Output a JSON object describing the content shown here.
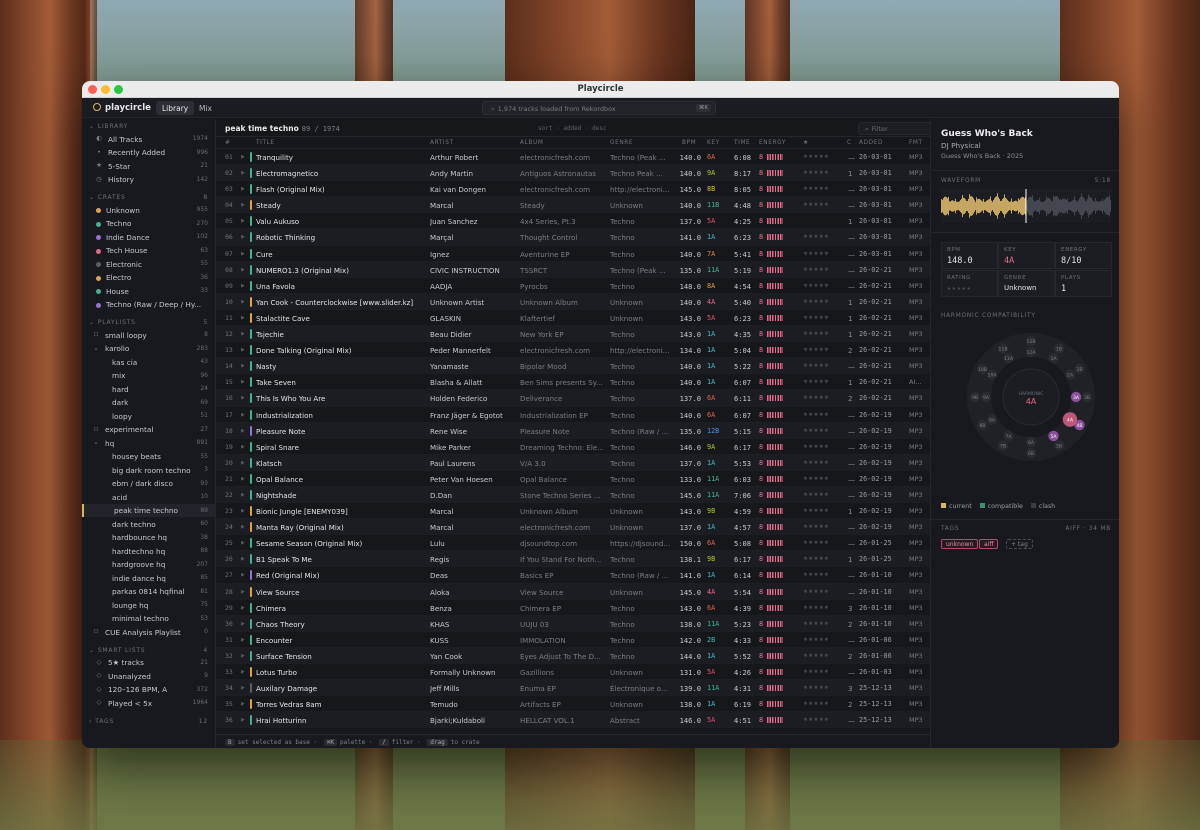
{
  "window": {
    "title": "Playcircle"
  },
  "toolbar": {
    "brand": "playcircle",
    "tabs": [
      "Library",
      "Mix"
    ],
    "search_text": "1,974 tracks loaded from Rekordbox",
    "search_kbd": "⌘K"
  },
  "sidebar": {
    "library": {
      "label": "LIBRARY",
      "items": [
        {
          "label": "All Tracks",
          "count": "1974",
          "icon": "disc-icon"
        },
        {
          "label": "Recently Added",
          "count": "996",
          "icon": "dot-icon"
        },
        {
          "label": "5-Star",
          "count": "21",
          "icon": "star-icon"
        },
        {
          "label": "History",
          "count": "142",
          "icon": "clock-icon"
        }
      ]
    },
    "crates": {
      "label": "CRATES",
      "count": "8",
      "items": [
        {
          "label": "Unknown",
          "count": "955",
          "color": "#e0a24a"
        },
        {
          "label": "Techno",
          "count": "270",
          "color": "#4caf8a"
        },
        {
          "label": "Indie Dance",
          "count": "102",
          "color": "#9a72d6"
        },
        {
          "label": "Tech House",
          "count": "63",
          "color": "#e26a84"
        },
        {
          "label": "Electronic",
          "count": "55",
          "color": "#5a5d66"
        },
        {
          "label": "Electro",
          "count": "36",
          "color": "#e0a24a"
        },
        {
          "label": "House",
          "count": "33",
          "color": "#4caf8a"
        },
        {
          "label": "Techno (Raw / Deep / Hy...",
          "count": "",
          "color": "#9a72d6"
        }
      ]
    },
    "playlists": {
      "label": "PLAYLISTS",
      "count": "5",
      "items": [
        {
          "label": "small loopy",
          "count": "8",
          "depth": 0,
          "icon": "folder"
        },
        {
          "label": "karolio",
          "count": "283",
          "depth": 0,
          "icon": "chevron"
        },
        {
          "label": "kas cia",
          "count": "43",
          "depth": 1
        },
        {
          "label": "mix",
          "count": "96",
          "depth": 1
        },
        {
          "label": "hard",
          "count": "24",
          "depth": 1
        },
        {
          "label": "dark",
          "count": "69",
          "depth": 1
        },
        {
          "label": "loopy",
          "count": "51",
          "depth": 1
        },
        {
          "label": "experimental",
          "count": "27",
          "depth": 0,
          "icon": "folder"
        },
        {
          "label": "hq",
          "count": "891",
          "depth": 0,
          "icon": "chevron"
        },
        {
          "label": "housey beats",
          "count": "55",
          "depth": 1
        },
        {
          "label": "big dark room techno",
          "count": "3",
          "depth": 1
        },
        {
          "label": "ebm / dark disco",
          "count": "93",
          "depth": 1
        },
        {
          "label": "acid",
          "count": "10",
          "depth": 1
        },
        {
          "label": "peak time techno",
          "count": "89",
          "depth": 1,
          "selected": true
        },
        {
          "label": "dark techno",
          "count": "60",
          "depth": 1
        },
        {
          "label": "hardbounce hq",
          "count": "38",
          "depth": 1
        },
        {
          "label": "hardtechno hq",
          "count": "88",
          "depth": 1
        },
        {
          "label": "hardgroove hq",
          "count": "207",
          "depth": 1
        },
        {
          "label": "indie dance hq",
          "count": "85",
          "depth": 1
        },
        {
          "label": "parkas 0814 hqfinal",
          "count": "81",
          "depth": 1
        },
        {
          "label": "lounge hq",
          "count": "75",
          "depth": 1
        },
        {
          "label": "minimal techno",
          "count": "53",
          "depth": 1
        },
        {
          "label": "CUE Analysis Playlist",
          "count": "0",
          "depth": 0,
          "icon": "folder"
        }
      ]
    },
    "smart": {
      "label": "SMART LISTS",
      "count": "4",
      "items": [
        {
          "label": "5★ tracks",
          "count": "21"
        },
        {
          "label": "Unanalyzed",
          "count": "9"
        },
        {
          "label": "120–126 BPM, A",
          "count": "372"
        },
        {
          "label": "Played < 5x",
          "count": "1964"
        }
      ]
    },
    "tags": {
      "label": "TAGS",
      "count": "12"
    }
  },
  "main": {
    "title": "peak time techno",
    "count": "89 / 1974",
    "sort": "sort · added · desc",
    "filter_placeholder": "Filter",
    "columns": [
      "#",
      "TITLE",
      "ARTIST",
      "ALBUM",
      "GENRE",
      "BPM",
      "KEY",
      "TIME",
      "ENERGY",
      "★",
      "C",
      "ADDED",
      "FMT"
    ]
  },
  "tracks": [
    {
      "n": "01",
      "t": "Tranquility",
      "a": "Arthur Robert",
      "al": "electronicfresh.com",
      "g": "Techno (Peak ...",
      "bpm": "140.0",
      "key": "6A",
      "time": "6:08",
      "en": "8",
      "cue": "—",
      "add": "26-03-01",
      "fmt": "MP3",
      "c": "#4caf8a"
    },
    {
      "n": "02",
      "t": "Electromagnetico",
      "a": "Andy Martin",
      "al": "Antiguos Astronautas",
      "g": "Techno Peak ...",
      "bpm": "140.0",
      "key": "9A",
      "time": "8:17",
      "en": "8",
      "cue": "1",
      "add": "26-03-01",
      "fmt": "MP3",
      "c": "#4caf8a"
    },
    {
      "n": "03",
      "t": "Flash (Original Mix)",
      "a": "Kai van Dongen",
      "al": "electronicfresh.com",
      "g": "http://electroni...",
      "bpm": "145.0",
      "key": "8B",
      "time": "8:05",
      "en": "8",
      "cue": "—",
      "add": "26-03-01",
      "fmt": "MP3",
      "c": "#4caf8a"
    },
    {
      "n": "04",
      "t": "Steady",
      "a": "Marcal",
      "al": "Steady",
      "g": "Unknown",
      "bpm": "140.0",
      "key": "11B",
      "time": "4:48",
      "en": "8",
      "cue": "—",
      "add": "26-03-01",
      "fmt": "MP3",
      "c": "#e0a24a"
    },
    {
      "n": "05",
      "t": "Valu Aukuso",
      "a": "Juan Sanchez",
      "al": "4x4 Series, Pt.3",
      "g": "Techno",
      "bpm": "137.0",
      "key": "5A",
      "time": "4:25",
      "en": "8",
      "cue": "1",
      "add": "26-03-01",
      "fmt": "MP3",
      "c": "#4caf8a",
      "stars": "★★★★·"
    },
    {
      "n": "06",
      "t": "Robotic Thinking",
      "a": "Marçal",
      "al": "Thought Control",
      "g": "Techno",
      "bpm": "141.0",
      "key": "1A",
      "time": "6:23",
      "en": "8",
      "cue": "—",
      "add": "26-03-01",
      "fmt": "MP3",
      "c": "#4caf8a"
    },
    {
      "n": "07",
      "t": "Cure",
      "a": "Ignez",
      "al": "Aventurine EP",
      "g": "Techno",
      "bpm": "140.0",
      "key": "7A",
      "time": "5:41",
      "en": "8",
      "cue": "—",
      "add": "26-03-01",
      "fmt": "MP3",
      "c": "#4caf8a"
    },
    {
      "n": "08",
      "t": "NUMERO1.3 (Original Mix)",
      "a": "CIVIC INSTRUCTION",
      "al": "TSSRCT",
      "g": "Techno (Peak ...",
      "bpm": "135.0",
      "key": "11A",
      "time": "5:19",
      "en": "8",
      "cue": "—",
      "add": "26-02-21",
      "fmt": "MP3",
      "c": "#4caf8a"
    },
    {
      "n": "09",
      "t": "Una Favola",
      "a": "AADJA",
      "al": "Pyrocbs",
      "g": "Techno",
      "bpm": "148.0",
      "key": "8A",
      "time": "4:54",
      "en": "8",
      "cue": "—",
      "add": "26-02-21",
      "fmt": "MP3",
      "c": "#4caf8a"
    },
    {
      "n": "10",
      "t": "Yan Cook - Counterclockwise [www.slider.kz]",
      "a": "Unknown Artist",
      "al": "Unknown Album",
      "g": "Unknown",
      "bpm": "140.0",
      "key": "4A",
      "time": "5:40",
      "en": "8",
      "cue": "1",
      "add": "26-02-21",
      "fmt": "MP3",
      "c": "#e0a24a"
    },
    {
      "n": "11",
      "t": "Stalactite Cave",
      "a": "GLASKIN",
      "al": "Klaftertief",
      "g": "Unknown",
      "bpm": "143.0",
      "key": "5A",
      "time": "6:23",
      "en": "8",
      "cue": "1",
      "add": "26-02-21",
      "fmt": "MP3",
      "c": "#e0a24a"
    },
    {
      "n": "12",
      "t": "Tsjechie",
      "a": "Beau Didier",
      "al": "New York EP",
      "g": "Techno",
      "bpm": "143.0",
      "key": "1A",
      "time": "4:35",
      "en": "8",
      "cue": "1",
      "add": "26-02-21",
      "fmt": "MP3",
      "c": "#4caf8a"
    },
    {
      "n": "13",
      "t": "Done Talking (Original Mix)",
      "a": "Peder Mannerfelt",
      "al": "electronicfresh.com",
      "g": "http://electroni...",
      "bpm": "134.0",
      "key": "1A",
      "time": "5:04",
      "en": "8",
      "cue": "2",
      "add": "26-02-21",
      "fmt": "MP3",
      "c": "#4caf8a"
    },
    {
      "n": "14",
      "t": "Nasty",
      "a": "Yanamaste",
      "al": "Bipolar Mood",
      "g": "Techno",
      "bpm": "140.0",
      "key": "1A",
      "time": "5:22",
      "en": "8",
      "cue": "—",
      "add": "26-02-21",
      "fmt": "MP3",
      "c": "#4caf8a"
    },
    {
      "n": "15",
      "t": "Take Seven",
      "a": "Blasha & Allatt",
      "al": "Ben Sims presents Sy...",
      "g": "Techno",
      "bpm": "140.0",
      "key": "1A",
      "time": "6:07",
      "en": "8",
      "cue": "1",
      "add": "26-02-21",
      "fmt": "AI...",
      "c": "#4caf8a"
    },
    {
      "n": "16",
      "t": "This Is Who You Are",
      "a": "Holden Federico",
      "al": "Deliverance",
      "g": "Techno",
      "bpm": "137.0",
      "key": "6A",
      "time": "6:11",
      "en": "8",
      "cue": "2",
      "add": "26-02-21",
      "fmt": "MP3",
      "c": "#4caf8a"
    },
    {
      "n": "17",
      "t": "Industrialization",
      "a": "Franz Jäger & Egotot",
      "al": "Industrialization EP",
      "g": "Techno",
      "bpm": "140.0",
      "key": "6A",
      "time": "6:07",
      "en": "8",
      "cue": "—",
      "add": "26-02-19",
      "fmt": "MP3",
      "c": "#4caf8a"
    },
    {
      "n": "18",
      "t": "Pleasure Note",
      "a": "Rene Wise",
      "al": "Pleasure Note",
      "g": "Techno (Raw / ...",
      "bpm": "135.0",
      "key": "12B",
      "time": "5:15",
      "en": "8",
      "cue": "—",
      "add": "26-02-19",
      "fmt": "MP3",
      "c": "#9a72d6"
    },
    {
      "n": "19",
      "t": "Spiral Snare",
      "a": "Mike Parker",
      "al": "Dreaming Techno: Ele...",
      "g": "Techno",
      "bpm": "146.0",
      "key": "9A",
      "time": "6:17",
      "en": "8",
      "cue": "—",
      "add": "26-02-19",
      "fmt": "MP3",
      "c": "#4caf8a"
    },
    {
      "n": "20",
      "t": "Klatsch",
      "a": "Paul Laurens",
      "al": "V/A 3.0",
      "g": "Techno",
      "bpm": "137.0",
      "key": "1A",
      "time": "5:53",
      "en": "8",
      "cue": "—",
      "add": "26-02-19",
      "fmt": "MP3",
      "c": "#4caf8a"
    },
    {
      "n": "21",
      "t": "Opal Balance",
      "a": "Peter Van Hoesen",
      "al": "Opal Balance",
      "g": "Techno",
      "bpm": "133.0",
      "key": "11A",
      "time": "6:03",
      "en": "8",
      "cue": "—",
      "add": "26-02-19",
      "fmt": "MP3",
      "c": "#4caf8a"
    },
    {
      "n": "22",
      "t": "Nightshade",
      "a": "D.Dan",
      "al": "Stone Techno Series ...",
      "g": "Techno",
      "bpm": "145.0",
      "key": "11A",
      "time": "7:06",
      "en": "8",
      "cue": "—",
      "add": "26-02-19",
      "fmt": "MP3",
      "c": "#4caf8a"
    },
    {
      "n": "23",
      "t": "Bionic Jungle [ENEMY039]",
      "a": "Marcal",
      "al": "Unknown Album",
      "g": "Unknown",
      "bpm": "143.0",
      "key": "9B",
      "time": "4:59",
      "en": "8",
      "cue": "1",
      "add": "26-02-19",
      "fmt": "MP3",
      "c": "#e0a24a"
    },
    {
      "n": "24",
      "t": "Manta Ray (Original Mix)",
      "a": "Marcal",
      "al": "electronicfresh.com",
      "g": "Unknown",
      "bpm": "137.0",
      "key": "1A",
      "time": "4:57",
      "en": "8",
      "cue": "—",
      "add": "26-02-19",
      "fmt": "MP3",
      "c": "#e0a24a"
    },
    {
      "n": "25",
      "t": "Sesame Season (Original Mix)",
      "a": "Lulu",
      "al": "djsoundtop.com",
      "g": "https://djsound...",
      "bpm": "150.0",
      "key": "6A",
      "time": "5:08",
      "en": "8",
      "cue": "—",
      "add": "26-01-25",
      "fmt": "MP3",
      "c": "#4caf8a"
    },
    {
      "n": "26",
      "t": "B1 Speak To Me",
      "a": "Regis",
      "al": "If You Stand For Noth...",
      "g": "Techno",
      "bpm": "138.1",
      "key": "9B",
      "time": "6:17",
      "en": "8",
      "cue": "1",
      "add": "26-01-25",
      "fmt": "MP3",
      "c": "#4caf8a"
    },
    {
      "n": "27",
      "t": "Red (Original Mix)",
      "a": "Deas",
      "al": "Basics EP",
      "g": "Techno (Raw / ...",
      "bpm": "141.0",
      "key": "1A",
      "time": "6:14",
      "en": "8",
      "cue": "—",
      "add": "26-01-10",
      "fmt": "MP3",
      "c": "#9a72d6"
    },
    {
      "n": "28",
      "t": "View Source",
      "a": "Aloka",
      "al": "View Source",
      "g": "Unknown",
      "bpm": "145.0",
      "key": "4A",
      "time": "5:54",
      "en": "8",
      "cue": "—",
      "add": "26-01-10",
      "fmt": "MP3",
      "c": "#e0a24a"
    },
    {
      "n": "29",
      "t": "Chimera",
      "a": "Benza",
      "al": "Chimera EP",
      "g": "Techno",
      "bpm": "143.0",
      "key": "6A",
      "time": "4:39",
      "en": "8",
      "cue": "3",
      "add": "26-01-10",
      "fmt": "MP3",
      "c": "#4caf8a"
    },
    {
      "n": "30",
      "t": "Chaos Theory",
      "a": "KHAS",
      "al": "UUJU 03",
      "g": "Techno",
      "bpm": "138.0",
      "key": "11A",
      "time": "5:23",
      "en": "8",
      "cue": "2",
      "add": "26-01-10",
      "fmt": "MP3",
      "c": "#4caf8a"
    },
    {
      "n": "31",
      "t": "Encounter",
      "a": "KUSS",
      "al": "IMMOLATION",
      "g": "Techno",
      "bpm": "142.0",
      "key": "2B",
      "time": "4:33",
      "en": "8",
      "cue": "—",
      "add": "26-01-06",
      "fmt": "MP3",
      "c": "#4caf8a"
    },
    {
      "n": "32",
      "t": "Surface Tension",
      "a": "Yan Cook",
      "al": "Eyes Adjust To The D...",
      "g": "Techno",
      "bpm": "144.0",
      "key": "1A",
      "time": "5:52",
      "en": "8",
      "cue": "2",
      "add": "26-01-06",
      "fmt": "MP3",
      "c": "#4caf8a"
    },
    {
      "n": "33",
      "t": "Lotus Turbo",
      "a": "Formally Unknown",
      "al": "Gazillions",
      "g": "Unknown",
      "bpm": "131.0",
      "key": "5A",
      "time": "4:26",
      "en": "8",
      "cue": "—",
      "add": "26-01-03",
      "fmt": "MP3",
      "c": "#e0a24a"
    },
    {
      "n": "34",
      "t": "Auxilary Damage",
      "a": "Jeff Mills",
      "al": "Enuma EP",
      "g": "Électronique o...",
      "bpm": "139.0",
      "key": "11A",
      "time": "4:31",
      "en": "8",
      "cue": "3",
      "add": "25-12-13",
      "fmt": "MP3",
      "c": "#5a5d66"
    },
    {
      "n": "35",
      "t": "Torres Vedras 8am",
      "a": "Temudo",
      "al": "Artifacts EP",
      "g": "Unknown",
      "bpm": "138.0",
      "key": "1A",
      "time": "6:19",
      "en": "8",
      "cue": "2",
      "add": "25-12-13",
      "fmt": "MP3",
      "c": "#e0a24a"
    },
    {
      "n": "36",
      "t": "Hrai Hotturinn",
      "a": "Bjarki;Kuldaboli",
      "al": "HELLCAT VOL.1",
      "g": "Abstract",
      "bpm": "146.0",
      "key": "5A",
      "time": "4:51",
      "en": "8",
      "cue": "—",
      "add": "25-12-13",
      "fmt": "MP3",
      "c": "#4caf8a"
    }
  ],
  "status": {
    "k1": "B",
    "t1": "set selected as base ·",
    "k2": "⌘K",
    "t2": "palette ·",
    "k3": "/",
    "t3": "filter ·",
    "k4": "drag",
    "t4": "to crate"
  },
  "detail": {
    "title": "Guess Who's Back",
    "artist": "DJ Physical",
    "meta": "Guess Who's Back · 2025",
    "waveform_label": "WAVEFORM",
    "waveform_time": "5:18",
    "waveform_played": 0.5,
    "stats": [
      {
        "label": "BPM",
        "value": "148.0"
      },
      {
        "label": "KEY",
        "value": "4A"
      },
      {
        "label": "ENERGY",
        "value": "8/10"
      },
      {
        "label": "RATING",
        "value": "★★★★★"
      },
      {
        "label": "GENRE",
        "value": "Unknown"
      },
      {
        "label": "PLAYS",
        "value": "1"
      }
    ],
    "harmonic_label": "HARMONIC COMPATIBILITY",
    "wheel_center_label": "HARMONIC",
    "wheel_center_key": "4A",
    "wheel_outer": [
      "12B",
      "1B",
      "2B",
      "3B",
      "4B",
      "5B",
      "6B",
      "7B",
      "8B",
      "9B",
      "10B",
      "11B"
    ],
    "wheel_inner": [
      "12A",
      "1A",
      "2A",
      "3A",
      "4A",
      "5A",
      "6A",
      "7A",
      "8A",
      "9A",
      "10A",
      "11A"
    ],
    "legend": [
      {
        "label": "current",
        "color": "#d8b56a"
      },
      {
        "label": "compatible",
        "color": "#3f8f6f"
      },
      {
        "label": "clash",
        "color": "#3a3b42"
      }
    ],
    "tags_label": "TAGS",
    "tags_meta": "AIFF · 34 MB",
    "tags": [
      "unknown",
      "aiff"
    ],
    "add_tag": "+ tag"
  },
  "key_colors": {
    "1A": "#47b6c9",
    "2B": "#3fb8b0",
    "4A": "#e66a88",
    "5A": "#e0566a",
    "6A": "#e0644a",
    "7A": "#e08a3a",
    "8A": "#e0a23a",
    "8B": "#d6c23a",
    "9A": "#a8c93a",
    "9B": "#a8c93a",
    "11A": "#3fb38a",
    "11B": "#3fb38a",
    "12B": "#4a8fd6"
  }
}
